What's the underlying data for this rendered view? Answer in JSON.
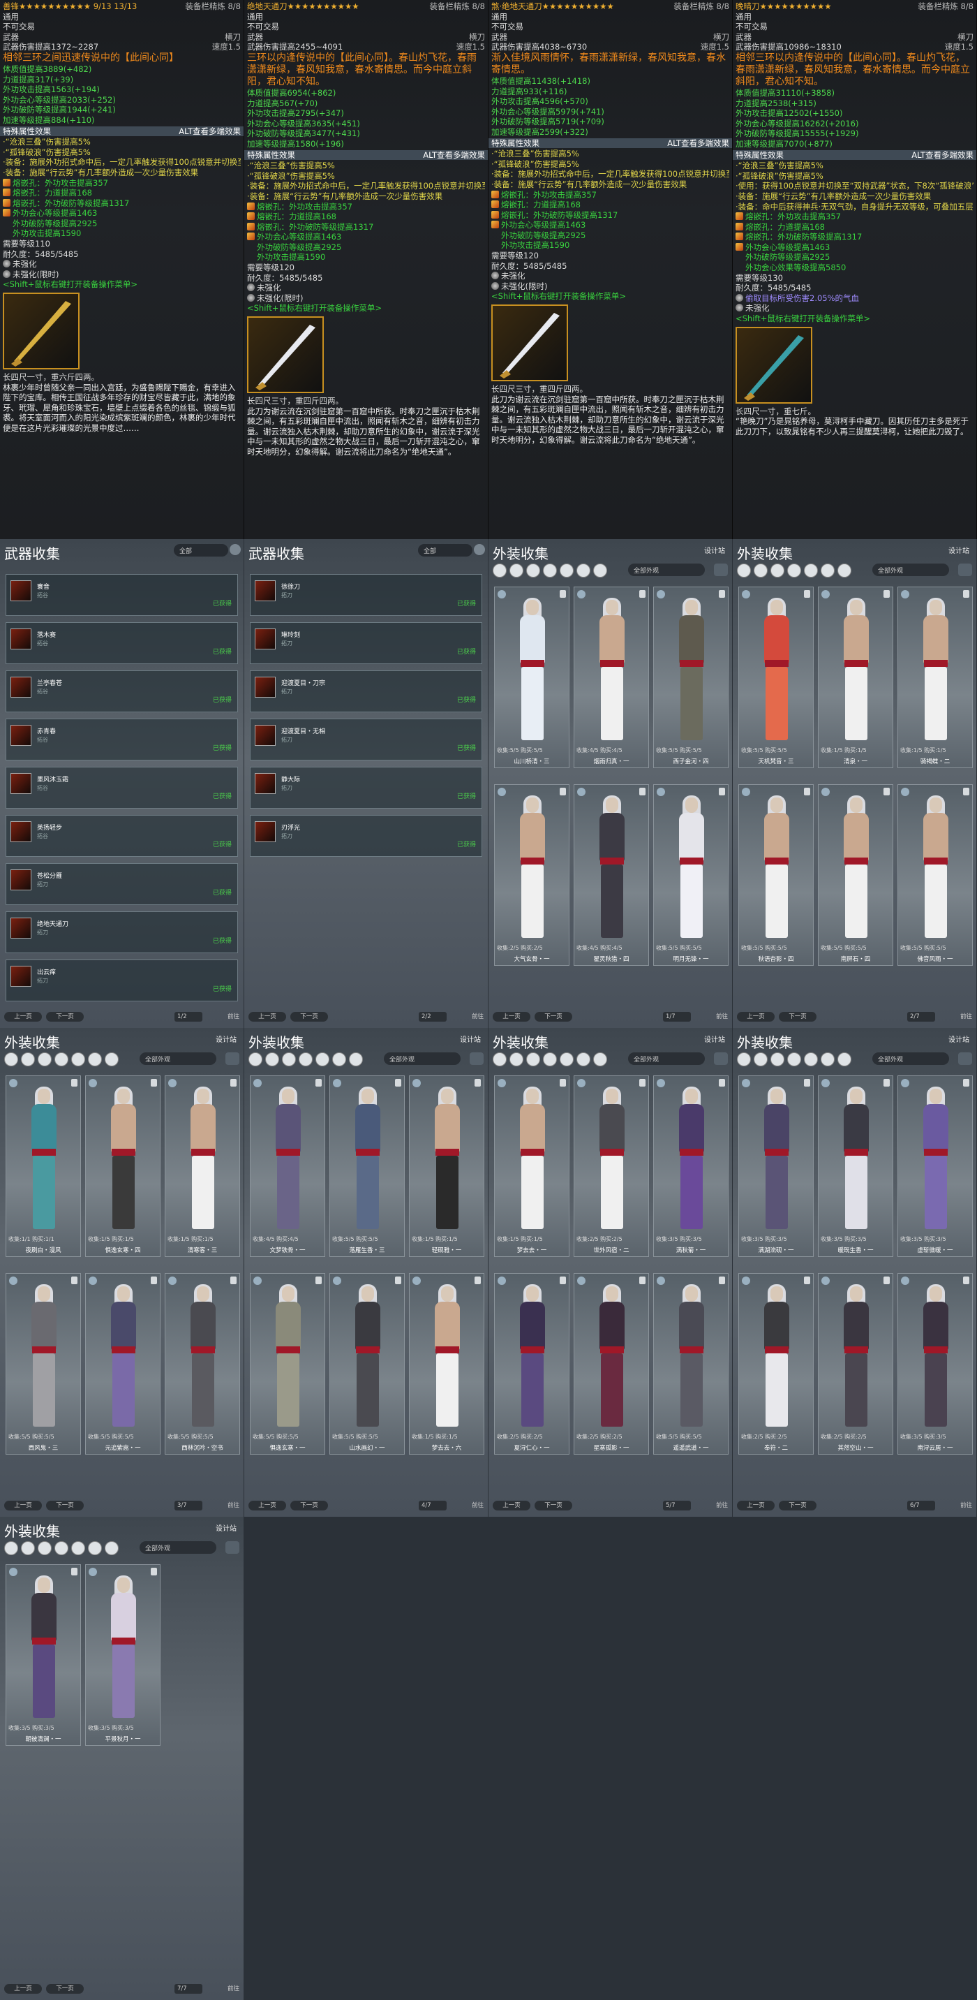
{
  "tooltips": [
    {
      "title": "善锋★★★★★★★★★★ 9/13 13/13",
      "rarity": "装备栏精炼 8/8",
      "usage": "通用",
      "trade": "不可交易",
      "type_label": "武器",
      "type_value": "横刀",
      "damage": "武器伤害提高1372~2287",
      "speed": "速度1.5",
      "attr_lines": [
        {
          "text": "体质值提高3889(+482)",
          "cls": "gn2"
        },
        {
          "text": "力道提高317(+39)",
          "cls": "gn2"
        },
        {
          "text": "外功攻击提高1563(+194)",
          "cls": "gn2"
        },
        {
          "text": "外功会心等级提高2033(+252)",
          "cls": "gn2"
        },
        {
          "text": "外功破防等级提高1944(+241)",
          "cls": "gn2"
        },
        {
          "text": "加速等级提高884(+110)",
          "cls": "gn2"
        }
      ],
      "banner": "相邻三环之间迅速传说中的【此间心同】",
      "section": "特殊属性效果",
      "alt_hint": "ALT查看多端效果",
      "effect_lines": [
        {
          "text": "·“沧浪三叠”伤害提高5%",
          "cls": "yel"
        },
        {
          "text": "·“孤锋破浪”伤害提高5%",
          "cls": "yel"
        },
        {
          "text": "·装备：施展外功招式命中后，一定几率触发获得100点锐意并切换至“双持破浪”状态，下8次“孤锋破浪”命中时对至多1个目标造成的伤害提高130%（优先当前选中目标），6秒内“断云势”无消耗。",
          "cls": "yel wrap"
        },
        {
          "text": "·装备：施展“行云势”有几率额外造成一次少量伤害效果",
          "cls": "yel wrap"
        }
      ],
      "gems": [
        "熔嵌孔：外功攻击提高357",
        "熔嵌孔：力道提高168",
        "熔嵌孔：外功破防等级提高1317"
      ],
      "colored": [
        "外功会心等级提高1463",
        "外功破防等级提高2925",
        "外功攻击提高1590"
      ],
      "req_level": "需要等级110",
      "durability": "耐久度：5485/5485",
      "unenh": "未强化",
      "unenh_limit": "未强化(限时)",
      "shift": "<Shift+鼠标右键打开装备操作菜单>",
      "size": "长四尺一寸，重六斤四两。",
      "lore": "林裹少年时曾随父亲一同出入宫廷，为盛鲁赐陛下赐金，有幸进入陛下的宝库。相传王国征战多年珍存的财宝尽皆藏于此，满地的象牙、玳瑁、犀角和珍珠宝石，墙壁上点缀着各色的丝毯、锦缎与狐裘。将天室面河而入的阳光染成缤紫斑斓的颜色，林裹的少年时代便是在这片光彩璀璨的光景中度过……"
    },
    {
      "title": "绝地天通刀★★★★★★★★★★",
      "rarity": "装备栏精炼 8/8",
      "usage": "通用",
      "trade": "不可交易",
      "type_label": "武器",
      "type_value": "横刀",
      "damage": "武器伤害提高2455~4091",
      "speed": "速度1.5",
      "attr_lines": [
        {
          "text": "体质值提高6954(+862)",
          "cls": "gn2"
        },
        {
          "text": "力道提高567(+70)",
          "cls": "gn2"
        },
        {
          "text": "外功攻击提高2795(+347)",
          "cls": "gn2"
        },
        {
          "text": "外功会心等级提高3635(+451)",
          "cls": "gn2"
        },
        {
          "text": "外功破防等级提高3477(+431)",
          "cls": "gn2"
        },
        {
          "text": "加速等级提高1580(+196)",
          "cls": "gn2"
        }
      ],
      "banner": "三环以内逢传说中的【此间心同】。春山灼飞花，春雨潇潇新绿，春风知我意，春水寄情思。而今中庭立斜阳，君心知不知。",
      "section": "特殊属性效果",
      "alt_hint": "ALT查看多端效果",
      "effect_lines": [
        {
          "text": "·“沧浪三叠”伤害提高5%",
          "cls": "yel"
        },
        {
          "text": "·“孤锋破浪”伤害提高5%",
          "cls": "yel"
        },
        {
          "text": "·装备：施展外功招式命中后，一定几率触发获得100点锐意并切换至“双持破浪”状态，下8次“孤锋破浪”命中时对至多1个目标造成的伤害提高130%（优先当前选中目标），6秒内“断云势”无消耗。",
          "cls": "yel wrap"
        },
        {
          "text": "·装备：施展“行云势”有几率额外造成一次少量伤害效果",
          "cls": "yel wrap"
        }
      ],
      "gems": [
        "熔嵌孔：外功攻击提高357",
        "熔嵌孔：力道提高168",
        "熔嵌孔：外功破防等级提高1317"
      ],
      "colored": [
        "外功会心等级提高1463",
        "外功破防等级提高2925",
        "外功攻击提高1590"
      ],
      "req_level": "需要等级120",
      "durability": "耐久度：5485/5485",
      "unenh": "未强化",
      "unenh_limit": "未强化(限时)",
      "shift": "<Shift+鼠标右键打开装备操作菜单>",
      "size": "长四尺三寸，重四斤四两。",
      "lore": "此刀为谢云流在沉剑驻窟第一百窟中所获。时奉刀之匣沉于枯木荆棘之间，有五彩斑斓自匣中流出，照闻有斩木之音，细辨有初击力量。谢云流独入枯木荆棘，却助刀意所生的幻象中，谢云流于深光中与一未知其形的虚然之物大战三日，最后一刀斩开混沌之心，窜时天地明分，幻象得解。谢云流将此刀命名为“绝地天通”。"
    },
    {
      "title": "煞·绝地天通刀★★★★★★★★★★",
      "rarity": "装备栏精炼 8/8",
      "usage": "通用",
      "trade": "不可交易",
      "type_label": "武器",
      "type_value": "横刀",
      "damage": "武器伤害提高4038~6730",
      "speed": "速度1.5",
      "attr_lines": [
        {
          "text": "体质值提高11438(+1418)",
          "cls": "gn2"
        },
        {
          "text": "力道提高933(+116)",
          "cls": "gn2"
        },
        {
          "text": "外功攻击提高4596(+570)",
          "cls": "gn2"
        },
        {
          "text": "外功会心等级提高5979(+741)",
          "cls": "gn2"
        },
        {
          "text": "外功破防等级提高5719(+709)",
          "cls": "gn2"
        },
        {
          "text": "加速等级提高2599(+322)",
          "cls": "gn2"
        }
      ],
      "banner": "渐入佳境风雨情怀，春雨潇潇新绿，春风知我意，春水寄情思。",
      "section": "特殊属性效果",
      "alt_hint": "ALT查看多端效果",
      "effect_lines": [
        {
          "text": "·“沧浪三叠”伤害提高5%",
          "cls": "yel"
        },
        {
          "text": "·“孤锋破浪”伤害提高5%",
          "cls": "yel"
        },
        {
          "text": "·装备：施展外功招式命中后，一定几率触发获得100点锐意并切换至“双持破浪”状态，下8次“孤锋破浪”命中时对至多1个目标造成的伤害提高130%（优先当前选中目标），6秒内“断云势”无消耗。",
          "cls": "yel wrap"
        },
        {
          "text": "·装备：施展“行云势”有几率额外造成一次少量伤害效果",
          "cls": "yel wrap"
        }
      ],
      "gems": [
        "熔嵌孔：外功攻击提高357",
        "熔嵌孔：力道提高168",
        "熔嵌孔：外功破防等级提高1317"
      ],
      "colored": [
        "外功会心等级提高1463",
        "外功破防等级提高2925",
        "外功攻击提高1590"
      ],
      "req_level": "需要等级120",
      "durability": "耐久度：5485/5485",
      "unenh": "未强化",
      "unenh_limit": "未强化(限时)",
      "shift": "<Shift+鼠标右键打开装备操作菜单>",
      "size": "长四尺三寸，重四斤四两。",
      "lore": "此刀为谢云流在沉剑驻窟第一百窟中所获。时奉刀之匣沉于枯木荆棘之间，有五彩斑斓自匣中流出，照闻有斩木之音，细辨有初击力量。谢云流独入枯木荆棘，却助刀意所生的幻象中，谢云流于深光中与一未知其形的虚然之物大战三日，最后一刀斩开混沌之心，窜时天地明分，幻象得解。谢云流将此刀命名为“绝地天通”。"
    },
    {
      "title": "晚晴刀★★★★★★★★★★",
      "rarity": "装备栏精炼 8/8",
      "usage": "通用",
      "trade": "不可交易",
      "type_label": "武器",
      "type_value": "横刀",
      "damage": "武器伤害提高10986~18310",
      "speed": "速度1.5",
      "attr_lines": [
        {
          "text": "体质值提高31110(+3858)",
          "cls": "gn2"
        },
        {
          "text": "力道提高2538(+315)",
          "cls": "gn2"
        },
        {
          "text": "外功攻击提高12502(+1550)",
          "cls": "gn2"
        },
        {
          "text": "外功会心等级提高16262(+2016)",
          "cls": "gn2"
        },
        {
          "text": "外功破防等级提高15555(+1929)",
          "cls": "gn2"
        },
        {
          "text": "加速等级提高7070(+877)",
          "cls": "gn2"
        }
      ],
      "banner": "相邻三环以内逢传说中的【此间心同】。春山灼飞花，春雨潇潇新绿，春风知我意，春水寄情思。而今中庭立斜阳，君心知不知。",
      "section": "特殊属性效果",
      "alt_hint": "ALT查看多端效果",
      "effect_lines": [
        {
          "text": "·“沧浪三叠”伤害提高5%",
          "cls": "yel"
        },
        {
          "text": "·“孤锋破浪”伤害提高5%",
          "cls": "yel"
        },
        {
          "text": "·使用：获得100点锐意并切换至“双持武器”状态，下8次“孤锋破浪”命中时对至多1个目标造成的伤害提高130%（优先当前选中目标），6秒内“断云势”无消耗。调息时间50秒",
          "cls": "yel wrap"
        },
        {
          "text": "·装备：施展“行云势”有几率额外造成一次少量伤害效果",
          "cls": "yel wrap"
        },
        {
          "text": "·装备：命中后获得神兵·无双气劲，自身提升无双等级，可叠加五层，持续6秒",
          "cls": "yel wrap"
        }
      ],
      "gems": [
        "熔嵌孔：外功攻击提高357",
        "熔嵌孔：力道提高168",
        "熔嵌孔：外功破防等级提高1317"
      ],
      "colored": [
        "外功会心等级提高1463",
        "外功破防等级提高2925",
        "外功会心效果等级提高5850"
      ],
      "req_level": "需要等级130",
      "durability": "耐久度：5485/5485",
      "extra": "偷取目标所受伤害2.05%的气血",
      "unenh": "未强化",
      "unenh_limit": "",
      "shift": "<Shift+鼠标右键打开装备操作菜单>",
      "size": "长四尺一寸，重七斤。",
      "lore": "“艳晚刀”乃是晁铭养母，莫浔柯手中藏刀。因其历任刀主多是死于此刀刀下，以致晁铭有不少人再三提醒莫浔柯，让她把此刀毁了。"
    }
  ],
  "weapon_panels": [
    {
      "title": "武器收集",
      "filter": "全部",
      "items": [
        {
          "name": "寰音",
          "sub": "拓谷",
          "owned": "已获得"
        },
        {
          "name": "落木赛",
          "sub": "拓谷",
          "owned": "已获得"
        },
        {
          "name": "兰亭春苍",
          "sub": "拓谷",
          "owned": "已获得"
        },
        {
          "name": "赤青春",
          "sub": "拓谷",
          "owned": "已获得"
        },
        {
          "name": "墨风沐玉霜",
          "sub": "拓谷",
          "owned": "已获得"
        },
        {
          "name": "英扬轻步",
          "sub": "拓谷",
          "owned": "已获得"
        },
        {
          "name": "苍松分雁",
          "sub": "拓刀",
          "owned": "已获得"
        },
        {
          "name": "绝地天通刀",
          "sub": "拓刀",
          "owned": "已获得"
        },
        {
          "name": "出云痒",
          "sub": "拓刀",
          "owned": "已获得"
        }
      ],
      "page": "1",
      "page_total": "/2"
    },
    {
      "title": "武器收集",
      "filter": "全部",
      "items": [
        {
          "name": "徐徐刀",
          "sub": "拓刀",
          "owned": "已获得"
        },
        {
          "name": "琳玲刻",
          "sub": "拓刀",
          "owned": "已获得"
        },
        {
          "name": "迎渡夏目・刀宗",
          "sub": "拓刀",
          "owned": "已获得"
        },
        {
          "name": "迎渡夏目・无相",
          "sub": "拓刀",
          "owned": "已获得"
        },
        {
          "name": "静大际",
          "sub": "拓刀",
          "owned": "已获得"
        },
        {
          "name": "刃浮光",
          "sub": "拓刀",
          "owned": "已获得"
        }
      ],
      "page": "2",
      "page_total": "/2"
    }
  ],
  "outfit_panels": [
    {
      "title": "外装收集",
      "setting": "设计站",
      "filter": "全部外观",
      "page": "1",
      "page_total": "/7",
      "cards": [
        {
          "name": "山川桥清・三",
          "stat": "收集:5/5   购买:5/5",
          "torso": "#dfe7f0",
          "legs": "#e8eef5"
        },
        {
          "name": "烟雨归真・一",
          "stat": "收集:4/5   购买:4/5",
          "torso": "#c9a88f",
          "legs": "#f0f0f0"
        },
        {
          "name": "西子金河・四",
          "stat": "收集:5/5   购买:5/5",
          "torso": "#5e5a4e",
          "legs": "#6b6b5e"
        },
        {
          "name": "大气玄骨・一",
          "stat": "收集:2/5   购买:2/5",
          "torso": "#c9a88f",
          "legs": "#f0f0f0"
        },
        {
          "name": "翟灵秋猎・四",
          "stat": "收集:4/5   购买:4/5",
          "torso": "#3c3a44",
          "legs": "#3c3a44"
        },
        {
          "name": "明月无锋・一",
          "stat": "收集:5/5   购买:5/5",
          "torso": "#e4e4ea",
          "legs": "#f0f0f6"
        }
      ]
    },
    {
      "title": "外装收集",
      "setting": "设计站",
      "filter": "全部外观",
      "page": "2",
      "page_total": "/7",
      "cards": [
        {
          "name": "天机梵音・三",
          "stat": "收集:5/5   购买:5/5",
          "torso": "#d44a3c",
          "legs": "#e46a4c"
        },
        {
          "name": "清泉・一",
          "stat": "收集:1/5   购买:1/5",
          "torso": "#c9a88f",
          "legs": "#f0f0f0"
        },
        {
          "name": "骑褐蝶・二",
          "stat": "收集:1/5   购买:1/5",
          "torso": "#c9a88f",
          "legs": "#f0f0f0"
        },
        {
          "name": "秋语杳影・四",
          "stat": "收集:5/5   购买:5/5",
          "torso": "#c9a88f",
          "legs": "#f0f0f0"
        },
        {
          "name": "南屏石・四",
          "stat": "收集:5/5   购买:5/5",
          "torso": "#c9a88f",
          "legs": "#f0f0f0"
        },
        {
          "name": "佛音风雨・一",
          "stat": "收集:5/5   购买:5/5",
          "torso": "#c9a88f",
          "legs": "#f0f0f0"
        }
      ]
    },
    {
      "title": "外装收集",
      "setting": "设计站",
      "filter": "全部外观",
      "page": "3",
      "page_total": "/7",
      "cards": [
        {
          "name": "夜刷白・漫风",
          "stat": "收集:1/1   购买:1/1",
          "torso": "#3c8c98",
          "legs": "#4a9aa0"
        },
        {
          "name": "惧逸玄寒・四",
          "stat": "收集:1/5   购买:1/5",
          "torso": "#c9a88f",
          "legs": "#3a3a3a"
        },
        {
          "name": "清寒客・三",
          "stat": "收集:1/5   购买:1/5",
          "torso": "#c9a88f",
          "legs": "#f0f0f0"
        },
        {
          "name": "西风鬼・三",
          "stat": "收集:5/5   购买:5/5",
          "torso": "#6a6a70",
          "legs": "#a0a0a4"
        },
        {
          "name": "元追紫嵩・一",
          "stat": "收集:5/5   购买:5/5",
          "torso": "#4a4a6a",
          "legs": "#7a6aa8"
        },
        {
          "name": "西林沉吟・空书",
          "stat": "收集:5/5   购买:5/5",
          "torso": "#4a4a50",
          "legs": "#5a5a60"
        }
      ]
    },
    {
      "title": "外装收集",
      "setting": "设计站",
      "filter": "全部外观",
      "page": "4",
      "page_total": "/7",
      "cards": [
        {
          "name": "文梦铁骨・一",
          "stat": "收集:4/5   购买:4/5",
          "torso": "#5a5478",
          "legs": "#6a6488"
        },
        {
          "name": "落雁生香・三",
          "stat": "收集:5/5   购买:5/5",
          "torso": "#4a5a7a",
          "legs": "#5a6a88"
        },
        {
          "name": "轻砚雅・一",
          "stat": "收集:1/5   购买:1/5",
          "torso": "#c9a88f",
          "legs": "#2a2a2a"
        },
        {
          "name": "惧逸玄寒・一",
          "stat": "收集:5/5   购买:5/5",
          "torso": "#8a8a7a",
          "legs": "#9a9a8a"
        },
        {
          "name": "山水画幻・一",
          "stat": "收集:5/5   购买:5/5",
          "torso": "#3a3a40",
          "legs": "#4a4a50"
        },
        {
          "name": "梦去去・六",
          "stat": "收集:1/5   购买:1/5",
          "torso": "#c9a88f",
          "legs": "#f0f0f0"
        }
      ]
    },
    {
      "title": "外装收集",
      "setting": "设计站",
      "filter": "全部外观",
      "page": "5",
      "page_total": "/7",
      "cards": [
        {
          "name": "梦去去・一",
          "stat": "收集:1/5   购买:1/5",
          "torso": "#c9a88f",
          "legs": "#f0f0f0"
        },
        {
          "name": "世外风宿・二",
          "stat": "收集:2/5   购买:2/5",
          "torso": "#4a4a50",
          "legs": "#f0f0f0"
        },
        {
          "name": "满秋菊・一",
          "stat": "收集:3/5   购买:3/5",
          "torso": "#4a3a6a",
          "legs": "#6a4a9a"
        },
        {
          "name": "夏浔仁心・一",
          "stat": "收集:2/5   购买:2/5",
          "torso": "#3a3050",
          "legs": "#5a4a80"
        },
        {
          "name": "星寒孤影・一",
          "stat": "收集:2/5   购买:2/5",
          "torso": "#3a2a3a",
          "legs": "#6a2a40"
        },
        {
          "name": "遥遥武道・一",
          "stat": "收集:5/5   购买:5/5",
          "torso": "#4a4a54",
          "legs": "#5a5a64"
        }
      ]
    },
    {
      "title": "外装收集",
      "setting": "设计站",
      "filter": "全部外观",
      "page": "6",
      "page_total": "/7",
      "cards": [
        {
          "name": "满湖流砚・一",
          "stat": "收集:3/5   购买:3/5",
          "torso": "#4a4466",
          "legs": "#5a5476"
        },
        {
          "name": "暖既生香・一",
          "stat": "收集:3/5   购买:3/5",
          "torso": "#3a3a44",
          "legs": "#e0e0e8"
        },
        {
          "name": "虚斩微暖・一",
          "stat": "收集:3/5   购买:3/5",
          "torso": "#6a5aa0",
          "legs": "#7a6ab0"
        },
        {
          "name": "奉符・二",
          "stat": "收集:2/5   购买:2/5",
          "torso": "#3a3a3e",
          "legs": "#e8e8ec"
        },
        {
          "name": "其然空山・一",
          "stat": "收集:2/5   购买:2/5",
          "torso": "#3a3640",
          "legs": "#4a4650"
        },
        {
          "name": "南浔云居・一",
          "stat": "收集:3/5   购买:3/5",
          "torso": "#3a3240",
          "legs": "#4a4250"
        }
      ]
    },
    {
      "title": "外装收集",
      "setting": "设计站",
      "filter": "全部外观",
      "page": "7",
      "page_total": "/7",
      "cards": [
        {
          "name": "朝彼清澜・一",
          "stat": "收集:3/5   购买:3/5",
          "torso": "#3a3640",
          "legs": "#5a4a80"
        },
        {
          "name": "平景秋月・一",
          "stat": "收集:3/5   购买:3/5",
          "torso": "#d8d0e0",
          "legs": "#8a7ab0"
        }
      ]
    }
  ],
  "pager": {
    "prev": "上一页",
    "next": "下一页",
    "go": "前往"
  }
}
